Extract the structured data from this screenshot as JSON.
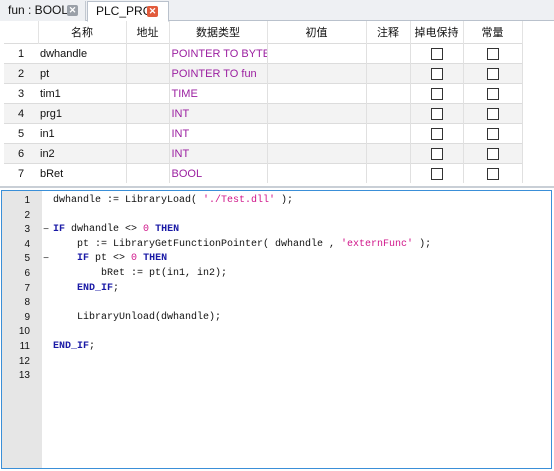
{
  "tabs": [
    {
      "label": "fun : BOOL",
      "active": false
    },
    {
      "label": "PLC_PRG",
      "active": true
    }
  ],
  "var_table": {
    "headers": [
      "",
      "名称",
      "地址",
      "数据类型",
      "初值",
      "注释",
      "掉电保持",
      "常量"
    ],
    "rows": [
      {
        "num": "1",
        "name": "dwhandle",
        "address": "",
        "type": "POINTER TO BYTE",
        "init": "",
        "comment": ""
      },
      {
        "num": "2",
        "name": "pt",
        "address": "",
        "type": "POINTER TO fun",
        "init": "",
        "comment": ""
      },
      {
        "num": "3",
        "name": "tim1",
        "address": "",
        "type": "TIME",
        "init": "",
        "comment": ""
      },
      {
        "num": "4",
        "name": "prg1",
        "address": "",
        "type": "INT",
        "init": "",
        "comment": ""
      },
      {
        "num": "5",
        "name": "in1",
        "address": "",
        "type": "INT",
        "init": "",
        "comment": ""
      },
      {
        "num": "6",
        "name": "in2",
        "address": "",
        "type": "INT",
        "init": "",
        "comment": ""
      },
      {
        "num": "7",
        "name": "bRet",
        "address": "",
        "type": "BOOL",
        "init": "",
        "comment": ""
      }
    ]
  },
  "code": {
    "line_numbers": [
      "1",
      "2",
      "3",
      "4",
      "5",
      "6",
      "7",
      "8",
      "9",
      "10",
      "11",
      "12",
      "13"
    ],
    "fold_markers": {
      "3": "−",
      "5": "−"
    },
    "lines": [
      [
        {
          "t": "dwhandle := LibraryLoad( ",
          "c": "id"
        },
        {
          "t": "'./Test.dll'",
          "c": "str"
        },
        {
          "t": " );",
          "c": "id"
        }
      ],
      [],
      [
        {
          "t": "IF",
          "c": "kw"
        },
        {
          "t": " dwhandle <> ",
          "c": "id"
        },
        {
          "t": "0",
          "c": "num"
        },
        {
          "t": " ",
          "c": "id"
        },
        {
          "t": "THEN",
          "c": "kw"
        }
      ],
      [
        {
          "t": "    pt := LibraryGetFunctionPointer( dwhandle , ",
          "c": "id"
        },
        {
          "t": "'externFunc'",
          "c": "str"
        },
        {
          "t": " );",
          "c": "id"
        }
      ],
      [
        {
          "t": "    ",
          "c": "id"
        },
        {
          "t": "IF",
          "c": "kw"
        },
        {
          "t": " pt <> ",
          "c": "id"
        },
        {
          "t": "0",
          "c": "num"
        },
        {
          "t": " ",
          "c": "id"
        },
        {
          "t": "THEN",
          "c": "kw"
        }
      ],
      [
        {
          "t": "        bRet := pt(in1, in2);",
          "c": "id"
        }
      ],
      [
        {
          "t": "    ",
          "c": "id"
        },
        {
          "t": "END_IF",
          "c": "kw"
        },
        {
          "t": ";",
          "c": "id"
        }
      ],
      [],
      [
        {
          "t": "    LibraryUnload(dwhandle);",
          "c": "id"
        }
      ],
      [],
      [
        {
          "t": "END_IF",
          "c": "kw"
        },
        {
          "t": ";",
          "c": "id"
        }
      ],
      [],
      []
    ]
  },
  "colors": {
    "type_text": "#9b1fa0",
    "keyword": "#1a1aa6",
    "literal": "#d0168a",
    "editor_border": "#3a8fd8"
  }
}
